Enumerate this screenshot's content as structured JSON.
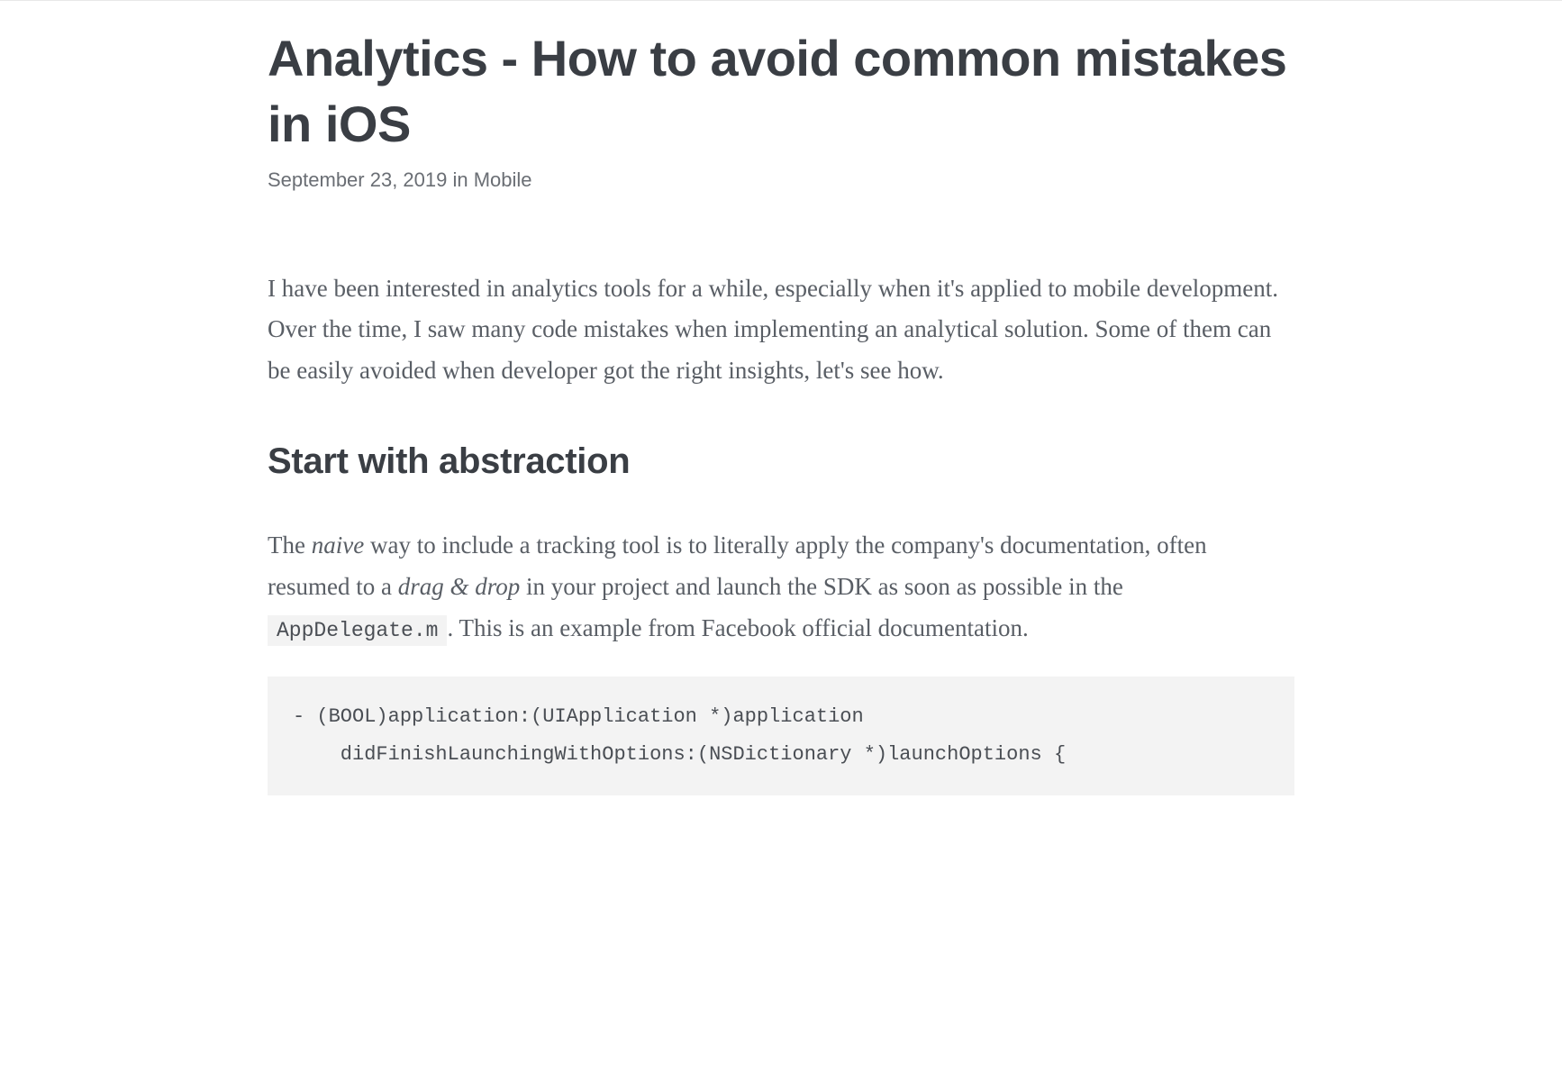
{
  "title": "Analytics - How to avoid common mistakes in iOS",
  "meta": {
    "date": "September 23, 2019",
    "in": " in ",
    "category": "Mobile"
  },
  "intro": "I have been interested in analytics tools for a while, especially when it's applied to mobile development. Over the time, I saw many code mistakes when implementing an analytical solution. Some of them can be easily avoided when developer got the right insights, let's see how.",
  "section": {
    "heading": "Start with abstraction",
    "p1_a": "The ",
    "p1_em1": "naive",
    "p1_b": " way to include a tracking tool is to literally apply the company's documentation, often resumed to a ",
    "p1_em2": "drag & drop",
    "p1_c": " in your project and launch the SDK as soon as possible in the ",
    "p1_code": "AppDelegate.m",
    "p1_d": ". This is an example from Facebook official documentation."
  },
  "code_block": "- (BOOL)application:(UIApplication *)application\n    didFinishLaunchingWithOptions:(NSDictionary *)launchOptions {"
}
